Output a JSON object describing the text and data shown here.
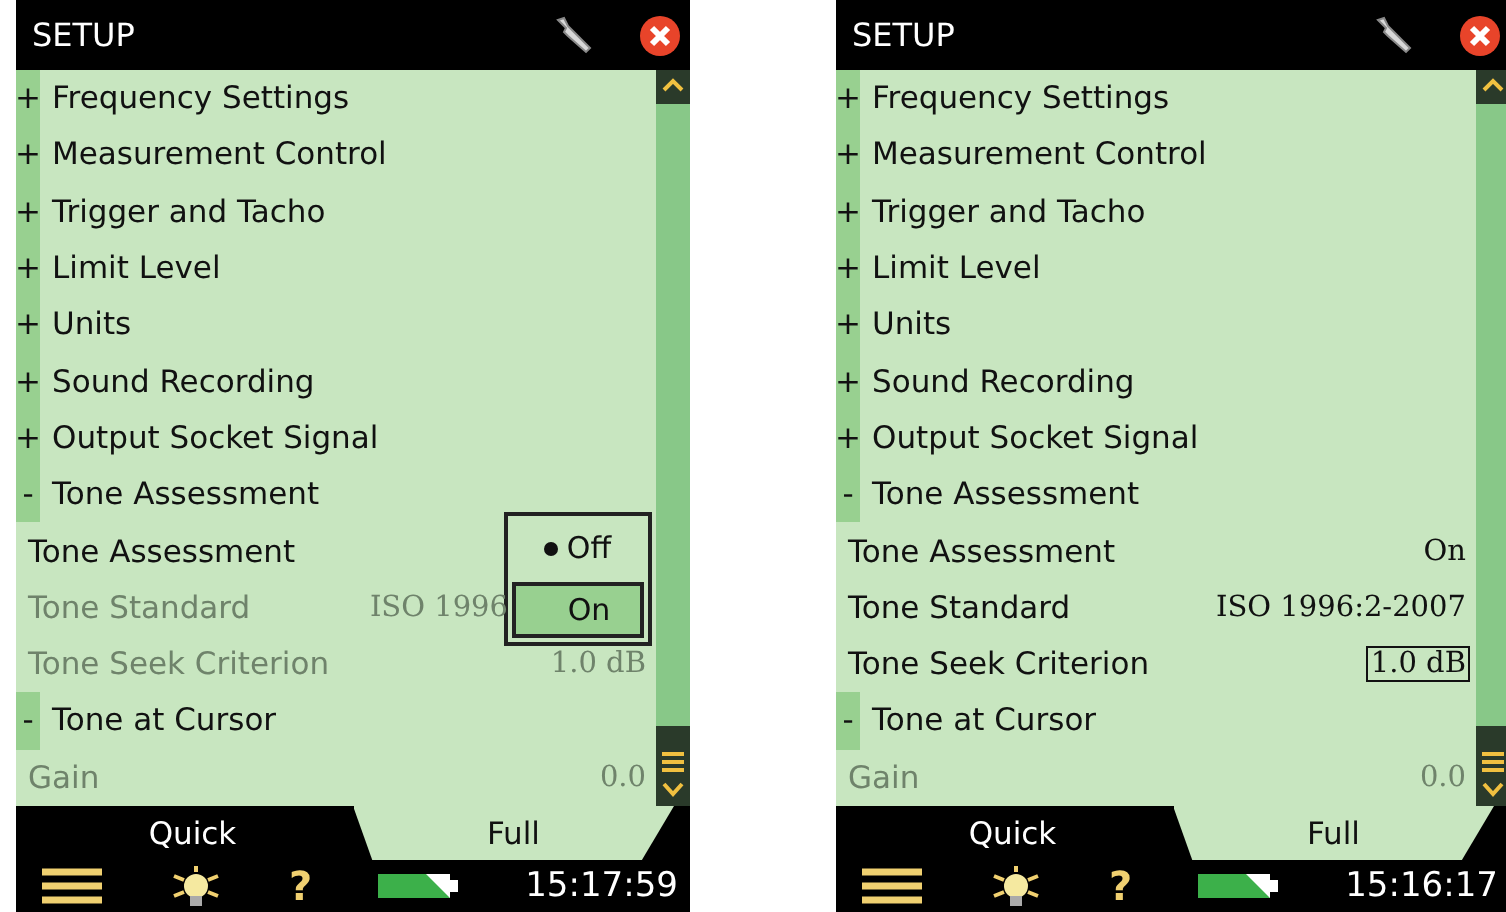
{
  "screens": [
    {
      "title": "SETUP",
      "time": "15:17:59",
      "rows": [
        {
          "kind": "group",
          "sign": "+",
          "label": "Frequency Settings"
        },
        {
          "kind": "group",
          "sign": "+",
          "label": "Measurement Control"
        },
        {
          "kind": "group",
          "sign": "+",
          "label": "Trigger and Tacho"
        },
        {
          "kind": "group",
          "sign": "+",
          "label": "Limit Level"
        },
        {
          "kind": "group",
          "sign": "+",
          "label": "Units"
        },
        {
          "kind": "group",
          "sign": "+",
          "label": "Sound Recording"
        },
        {
          "kind": "group",
          "sign": "+",
          "label": "Output Socket Signal"
        },
        {
          "kind": "group",
          "sign": "-",
          "label": "Tone Assessment"
        },
        {
          "kind": "setting",
          "label": "Tone Assessment",
          "disabled": false,
          "popup": {
            "options": [
              {
                "label": "Off",
                "current": true,
                "selected": false
              },
              {
                "label": "On",
                "current": false,
                "selected": true
              }
            ]
          }
        },
        {
          "kind": "setting",
          "label": "Tone Standard",
          "value": "ISO 1996",
          "disabled": true,
          "focused": false
        },
        {
          "kind": "setting",
          "label": "Tone Seek Criterion",
          "value": "1.0 dB",
          "disabled": true,
          "focused": false
        },
        {
          "kind": "group",
          "sign": "-",
          "label": "Tone at Cursor"
        },
        {
          "kind": "setting",
          "label": "Gain",
          "value": "0.0",
          "disabled": true,
          "focused": false
        }
      ],
      "tabs": [
        {
          "label": "Quick",
          "selected": false
        },
        {
          "label": "Full",
          "selected": true
        }
      ],
      "help": "?"
    },
    {
      "title": "SETUP",
      "time": "15:16:17",
      "rows": [
        {
          "kind": "group",
          "sign": "+",
          "label": "Frequency Settings"
        },
        {
          "kind": "group",
          "sign": "+",
          "label": "Measurement Control"
        },
        {
          "kind": "group",
          "sign": "+",
          "label": "Trigger and Tacho"
        },
        {
          "kind": "group",
          "sign": "+",
          "label": "Limit Level"
        },
        {
          "kind": "group",
          "sign": "+",
          "label": "Units"
        },
        {
          "kind": "group",
          "sign": "+",
          "label": "Sound Recording"
        },
        {
          "kind": "group",
          "sign": "+",
          "label": "Output Socket Signal"
        },
        {
          "kind": "group",
          "sign": "-",
          "label": "Tone Assessment"
        },
        {
          "kind": "setting",
          "label": "Tone Assessment",
          "value": "On",
          "disabled": false,
          "focused": false
        },
        {
          "kind": "setting",
          "label": "Tone Standard",
          "value": "ISO 1996:2-2007",
          "disabled": false,
          "focused": false
        },
        {
          "kind": "setting",
          "label": "Tone Seek Criterion",
          "value": "1.0 dB",
          "disabled": false,
          "focused": true
        },
        {
          "kind": "group",
          "sign": "-",
          "label": "Tone at Cursor"
        },
        {
          "kind": "setting",
          "label": "Gain",
          "value": "0.0",
          "disabled": true,
          "focused": false
        }
      ],
      "tabs": [
        {
          "label": "Quick",
          "selected": false
        },
        {
          "label": "Full",
          "selected": true
        }
      ],
      "help": "?"
    }
  ]
}
